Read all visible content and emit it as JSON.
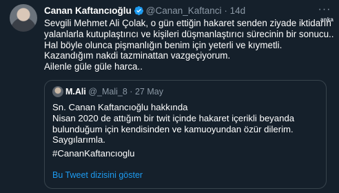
{
  "tweet": {
    "author_name": "Canan Kaftancıoğlu",
    "handle": "@Canan_Kaftanci",
    "separator": "·",
    "time": "14d",
    "more_label": "···",
    "lines": [
      "Sevgili Mehmet Ali Çolak, o gün ettiğin hakaret senden ziyade iktidarın",
      "yalanlarla kutuplaştırıcı ve kişileri düşmanlaştırıcı sürecinin bir sonucu..",
      "Hal böyle olunca pişmanlığın benim için yeterli ve kıymetli.",
      "Kazandığım nakdi tazminattan vazgeçiyorum.",
      "Ailenle güle güle harca.."
    ]
  },
  "watermark": "anka",
  "quoted_tweet": {
    "author_name": "M.Ali",
    "handle": "@_Mali_8",
    "separator": "·",
    "time": "27 May",
    "lines": [
      "Sn. Canan Kaftancıoğlu hakkında",
      "Nisan 2020 de attığım bir twit içinde hakaret içerikli beyanda",
      "bulunduğum için kendisinden ve kamuoyundan özür dilerim.",
      "Saygılarımla."
    ],
    "hashtag": "#CananKaftancıoglu",
    "thread_link": "Bu Tweet dizisini göster"
  },
  "colors": {
    "background": "#15202b",
    "muted_text": "#8b98a5",
    "link_blue": "#1d9bf0",
    "border": "#38444d"
  }
}
